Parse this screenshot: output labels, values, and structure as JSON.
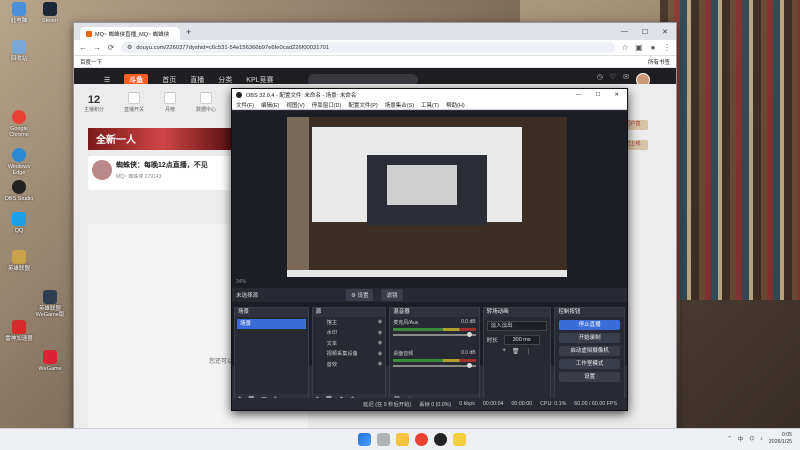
{
  "desktop": {
    "icons": [
      {
        "label": "此电脑",
        "color": "#4a90d9"
      },
      {
        "label": "Steam",
        "color": "#1b2838"
      },
      {
        "label": "回收站",
        "color": "#7aa7d6"
      },
      {
        "label": "Google Chrome",
        "color": "#e94235"
      },
      {
        "label": "Windows Edge",
        "color": "#2a8ad4"
      },
      {
        "label": "OBS Studio",
        "color": "#222"
      },
      {
        "label": "QQ",
        "color": "#1aa0e8"
      },
      {
        "label": "英雄联盟",
        "color": "#c8a24a"
      },
      {
        "label": "雷神加速器",
        "color": "#d82a2a"
      },
      {
        "label": "英雄联盟WeGame版",
        "color": "#2c3e50"
      },
      {
        "label": "WeGame",
        "color": "#d23"
      }
    ]
  },
  "chrome": {
    "tab_title": "MQ~ 蜘蛛侠直播_MQ~ 蜘蛛侠",
    "new_tab": "+",
    "url": "douyu.com/2260377dyshid=c6c531-54e156366b97e6fe0cad226f00031701",
    "bookmark": "百度一下",
    "bookmarks_right": "所有书签",
    "win_min": "—",
    "win_max": "☐",
    "win_close": "✕"
  },
  "douyu": {
    "logo": "斗鱼",
    "nav": [
      "首页",
      "直播",
      "分类",
      "KPL竞赛"
    ],
    "stats": [
      {
        "value": "12",
        "label": "主播积分"
      },
      {
        "value": "",
        "label": "直播开关"
      },
      {
        "value": "",
        "label": "月榜"
      },
      {
        "value": "",
        "label": "数据中心"
      }
    ],
    "banner": "全新一人",
    "room_title": "蜘蛛侠：每晚12点直播，不见",
    "room_sub": "MQ~ 蜘蛛侠  279143",
    "offline_text": "您还可以",
    "side_labels": [
      "门户直",
      "已上线"
    ]
  },
  "obs": {
    "title": "OBS 32.0.4 - 配置文件: 未命名 - 场景: 未命名",
    "menu": [
      "文件(F)",
      "编辑(E)",
      "视图(V)",
      "停靠窗口(D)",
      "配置文件(P)",
      "场景集合(S)",
      "工具(T)",
      "帮助(H)"
    ],
    "zoom": "34%",
    "no_source": "未选择源",
    "props_btn": "⚙ 设置",
    "filters_btn": "滤镜",
    "panels": {
      "scenes": "场景",
      "sources": "源",
      "mixer": "混音器",
      "transitions": "转场动画",
      "controls": "控制按钮"
    },
    "scenes": [
      "场景"
    ],
    "sources": [
      "馆主",
      "水印",
      "文本",
      "视频采集设备",
      "音效"
    ],
    "mixer": [
      {
        "name": "麦克风/Aux",
        "db": "0.0 dB"
      },
      {
        "name": "桌面音频",
        "db": "0.0 dB"
      }
    ],
    "transition": "淡入淡出",
    "duration_label": "时长",
    "duration": "300 ms",
    "controls": [
      "停止直播",
      "开始录制",
      "启动虚拟摄像机",
      "工作室模式",
      "设置"
    ],
    "status": {
      "delay": "延迟 (在 9 秒后开始)",
      "dropped": "丢帧 0 (0.0%)",
      "bitrate": "0 kbps",
      "stream_time": "00:00:04",
      "rec_time": "00:00:00",
      "cpu": "CPU: 0.1%",
      "fps": "60.00 / 60.00 FPS"
    }
  },
  "taskbar": {
    "ime": "中",
    "time": "0:05",
    "date": "2026/1/25"
  }
}
